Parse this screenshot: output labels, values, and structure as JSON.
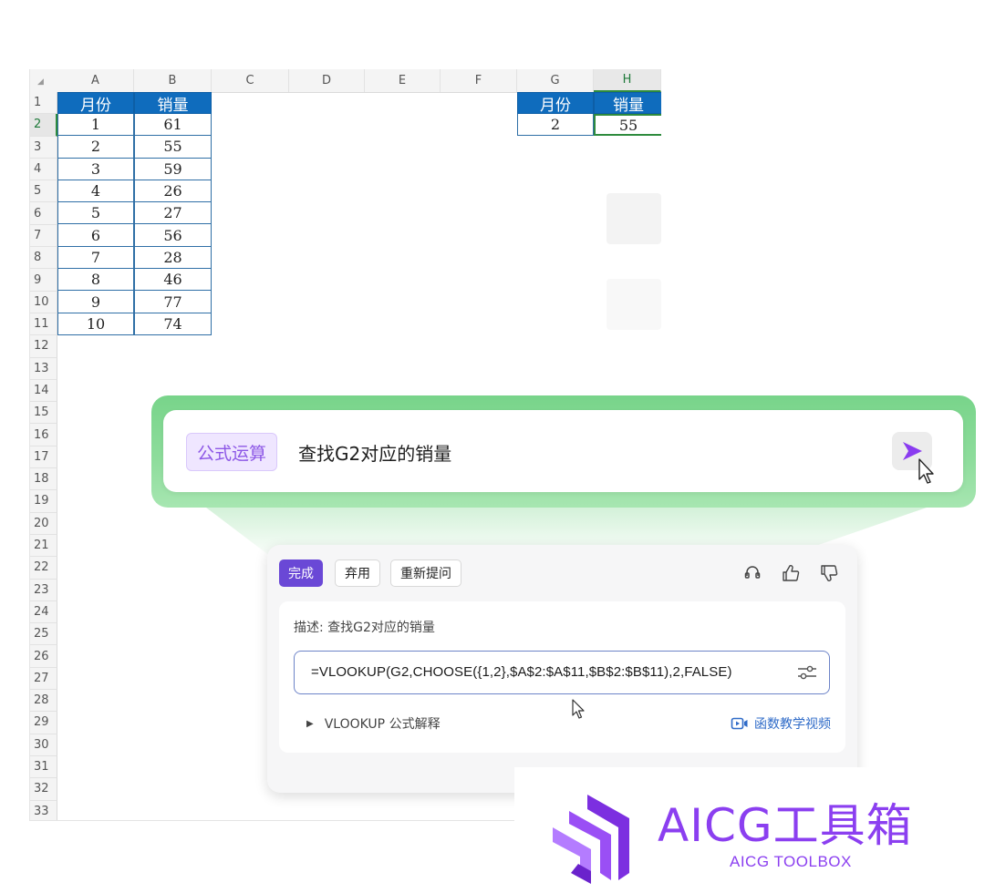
{
  "sheet": {
    "columns": [
      "A",
      "B",
      "C",
      "D",
      "E",
      "F",
      "G",
      "H"
    ],
    "active_column": "H",
    "rows": [
      "1",
      "2",
      "3",
      "4",
      "5",
      "6",
      "7",
      "8",
      "9",
      "10",
      "11",
      "12",
      "13",
      "14",
      "15",
      "16",
      "17",
      "18",
      "19",
      "20",
      "21",
      "22",
      "23",
      "24",
      "25",
      "26",
      "27",
      "28",
      "29",
      "30",
      "31",
      "32",
      "33"
    ],
    "active_row": "2",
    "left_table": {
      "headers": [
        "月份",
        "销量"
      ],
      "rows": [
        [
          "1",
          "61"
        ],
        [
          "2",
          "55"
        ],
        [
          "3",
          "59"
        ],
        [
          "4",
          "26"
        ],
        [
          "5",
          "27"
        ],
        [
          "6",
          "56"
        ],
        [
          "7",
          "28"
        ],
        [
          "8",
          "46"
        ],
        [
          "9",
          "77"
        ],
        [
          "10",
          "74"
        ]
      ]
    },
    "right_table": {
      "headers": [
        "月份",
        "销量"
      ],
      "rows": [
        [
          "2",
          "55"
        ]
      ]
    }
  },
  "prompt": {
    "tag": "公式运算",
    "text": "查找G2对应的销量"
  },
  "panel": {
    "buttons": {
      "done": "完成",
      "discard": "弃用",
      "reask": "重新提问"
    },
    "description": "描述: 查找G2对应的销量",
    "formula": "=VLOOKUP(G2,CHOOSE({1,2},$A$2:$A$11,$B$2:$B$11),2,FALSE)",
    "explain": "VLOOKUP 公式解释",
    "video_link": "函数教学视频"
  },
  "brand": {
    "name": "AICG工具箱",
    "subtitle": "AICG TOOLBOX",
    "color": "#8b3ff0"
  },
  "colors": {
    "accent": "#6a48d6",
    "header_blue": "#0f6cbd",
    "selection_green": "#2e8b3e",
    "prompt_green": "#78d48a"
  }
}
